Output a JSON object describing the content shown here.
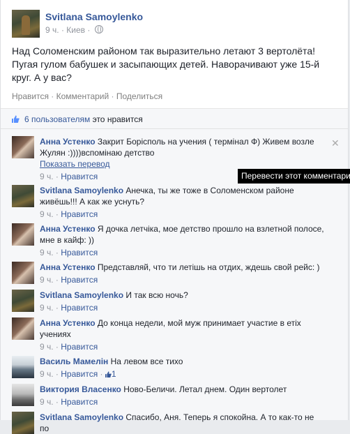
{
  "post": {
    "author": "Svitlana Samoylenko",
    "time": "9 ч.",
    "location": "Киев",
    "text": "Над Соломенским районом так выразительно летают 3 вертолёта! Пугая гулом бабушек и засыпающих детей. Наворачивают уже 15-й круг. А у вас?",
    "actions": {
      "like": "Нравится",
      "comment": "Комментарий",
      "share": "Поделиться",
      "sep": " · "
    }
  },
  "likes": {
    "count_text": "6 пользователям",
    "suffix": " это нравится"
  },
  "tooltip": "Перевести этот комментарий",
  "comments": [
    {
      "author": "Анна Устенко",
      "text": "Закрит Борісполь на учения ( термінал Ф) Живем возле Жулян :))))вспомінаю детство",
      "translate": "Показать перевод",
      "time": "9 ч.",
      "like": "Нравится"
    },
    {
      "author": "Svitlana Samoylenko",
      "text": "Анечка, ты же тоже в Соломенском районе живёшь!!! А как же уснуть?",
      "time": "9 ч.",
      "like": "Нравится"
    },
    {
      "author": "Анна Устенко",
      "text": "Я дочка летчіка, мое детство прошло на взлетной полосе, мне в кайф: ))",
      "time": "9 ч.",
      "like": "Нравится"
    },
    {
      "author": "Анна Устенко",
      "text": "Представляй, что ти летішь на отдих, ждешь свой рейс: )",
      "time": "9 ч.",
      "like": "Нравится"
    },
    {
      "author": "Svitlana Samoylenko",
      "text": "И так всю ночь?",
      "time": "9 ч.",
      "like": "Нравится"
    },
    {
      "author": "Анна Устенко",
      "text": "До конца недели, мой муж принимает участие в етіх учениях",
      "time": "9 ч.",
      "like": "Нравится"
    },
    {
      "author": "Василь Мамелін",
      "text": "На левом все тихо",
      "time": "9 ч.",
      "like": "Нравится",
      "likes": "1"
    },
    {
      "author": "Виктория Власенко",
      "text": "Ново-Беличи. Летал днем. Один вертолет",
      "time": "9 ч.",
      "like": "Нравится"
    },
    {
      "author": "Svitlana Samoylenko",
      "text": "Спасибо, Аня. Теперь я спокойна. А то как-то не по"
    }
  ],
  "colors": {
    "link": "#365899",
    "meta": "#90949c",
    "bg": "#f6f7f9"
  }
}
